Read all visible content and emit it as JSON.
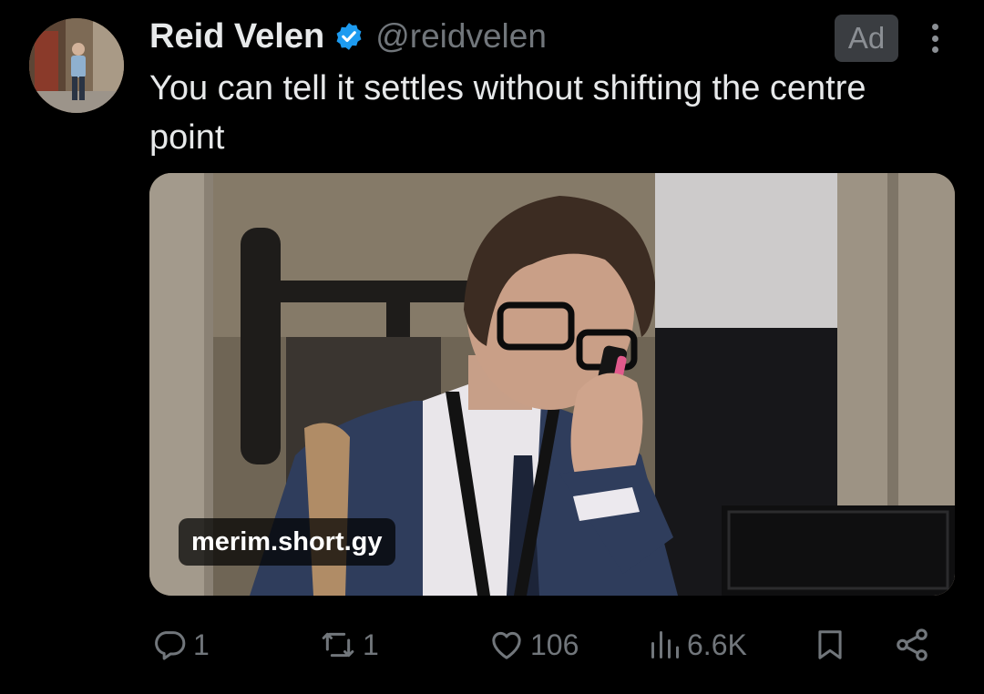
{
  "tweet": {
    "display_name": "Reid Velen",
    "handle": "@reidvelen",
    "ad_label": "Ad",
    "text": "You can tell it settles without shifting the centre point",
    "verified": true
  },
  "media": {
    "link_label": "merim.short.gy"
  },
  "actions": {
    "reply": {
      "icon": "reply-icon",
      "count": "1"
    },
    "retweet": {
      "icon": "retweet-icon",
      "count": "1"
    },
    "like": {
      "icon": "heart-icon",
      "count": "106"
    },
    "views": {
      "icon": "views-icon",
      "count": "6.6K"
    },
    "bookmark": {
      "icon": "bookmark-icon"
    },
    "share": {
      "icon": "share-icon"
    }
  },
  "colors": {
    "background": "#000000",
    "primary_text": "#e7e9ea",
    "secondary_text": "#71767b",
    "verified_blue": "#1d9bf0",
    "ad_badge_bg": "#3a3d41"
  }
}
